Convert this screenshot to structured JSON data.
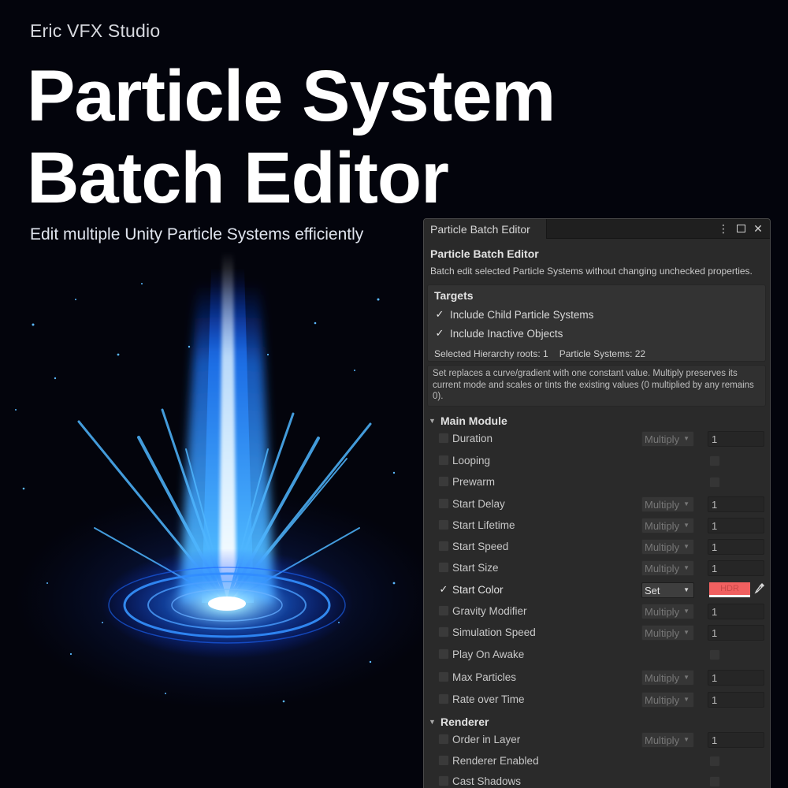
{
  "hero": {
    "studio": "Eric VFX Studio",
    "title_line1": "Particle System",
    "title_line2": "Batch Editor",
    "subtitle": "Edit multiple Unity Particle Systems efficiently"
  },
  "window": {
    "tab_title": "Particle Batch Editor",
    "menu_icon": "⋮",
    "close_icon": "✕"
  },
  "panel": {
    "heading": "Particle Batch Editor",
    "description": "Batch edit selected Particle Systems without changing unchecked properties."
  },
  "targets": {
    "label": "Targets",
    "include_children": "Include Child Particle Systems",
    "include_inactive": "Include Inactive Objects",
    "roots_text": "Selected Hierarchy roots: 1",
    "systems_text": "Particle Systems: 22"
  },
  "info": {
    "text": "Set replaces a curve/gradient with one constant value. Multiply preserves its current mode and scales or tints the existing values (0 multiplied by any remains 0)."
  },
  "main_module": {
    "label": "Main Module",
    "rows": {
      "duration": {
        "label": "Duration",
        "mode": "Multiply",
        "value": "1"
      },
      "looping": {
        "label": "Looping"
      },
      "prewarm": {
        "label": "Prewarm"
      },
      "start_delay": {
        "label": "Start Delay",
        "mode": "Multiply",
        "value": "1"
      },
      "start_lifetime": {
        "label": "Start Lifetime",
        "mode": "Multiply",
        "value": "1"
      },
      "start_speed": {
        "label": "Start Speed",
        "mode": "Multiply",
        "value": "1"
      },
      "start_size": {
        "label": "Start Size",
        "mode": "Multiply",
        "value": "1"
      },
      "start_color": {
        "label": "Start Color",
        "mode": "Set",
        "swatch": "HDR",
        "color": "#f06060"
      },
      "gravity_modifier": {
        "label": "Gravity Modifier",
        "mode": "Multiply",
        "value": "1"
      },
      "simulation_speed": {
        "label": "Simulation Speed",
        "mode": "Multiply",
        "value": "1"
      },
      "play_on_awake": {
        "label": "Play On Awake"
      },
      "max_particles": {
        "label": "Max Particles",
        "mode": "Multiply",
        "value": "1"
      },
      "rate_over_time": {
        "label": "Rate over Time",
        "mode": "Multiply",
        "value": "1"
      }
    }
  },
  "renderer": {
    "label": "Renderer",
    "rows": {
      "order_in_layer": {
        "label": "Order in Layer",
        "mode": "Multiply",
        "value": "1"
      },
      "renderer_enabled": {
        "label": "Renderer Enabled"
      },
      "cast_shadows": {
        "label": "Cast Shadows"
      }
    }
  },
  "icons": {
    "check": "✓",
    "triangle": "▼",
    "dropdown_arrow": "▼",
    "eyedropper": "eyedropper-icon"
  }
}
